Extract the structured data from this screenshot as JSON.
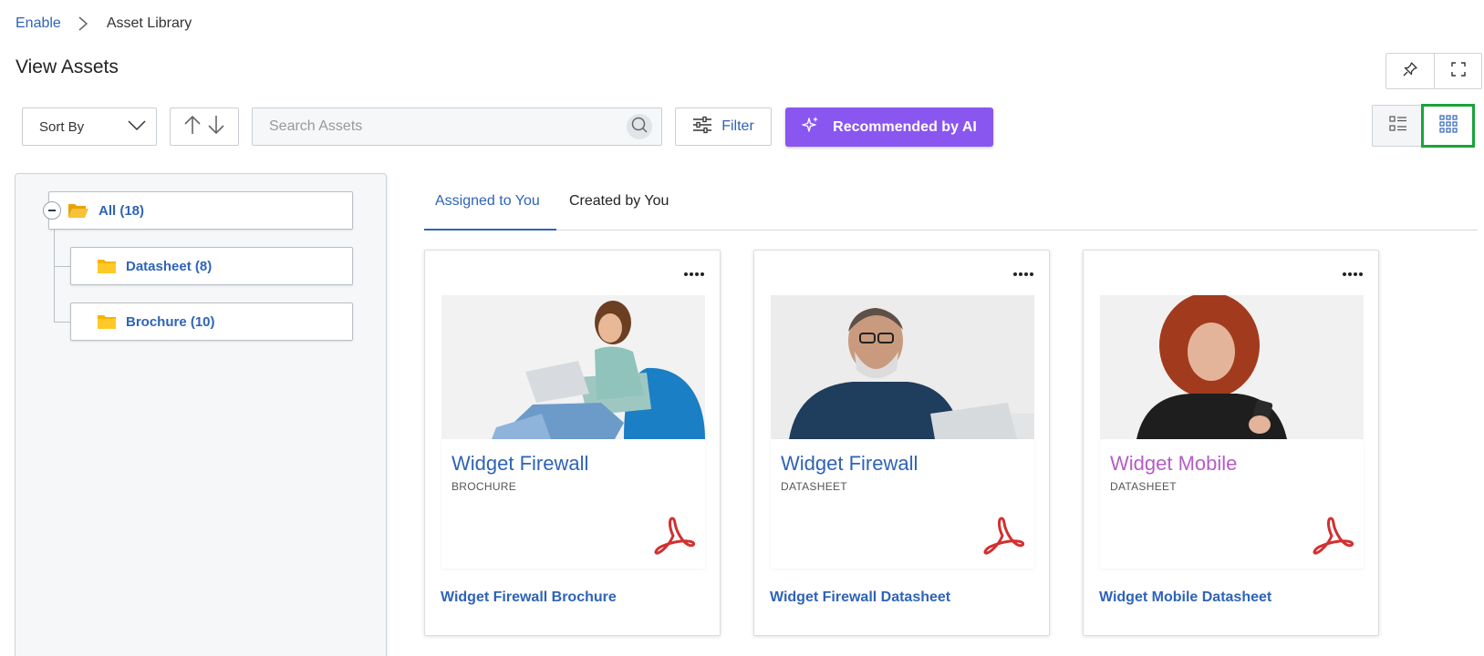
{
  "breadcrumb": {
    "root": "Enable",
    "current": "Asset Library"
  },
  "page": {
    "title": "View Assets"
  },
  "toolbar": {
    "sort_label": "Sort By",
    "search_placeholder": "Search Assets",
    "filter_label": "Filter",
    "ai_label": "Recommended by AI",
    "active_view": "grid"
  },
  "tree": {
    "root": {
      "label": "All (18)"
    },
    "children": [
      {
        "label": "Datasheet (8)"
      },
      {
        "label": "Brochure (10)"
      }
    ]
  },
  "tabs": [
    {
      "label": "Assigned to You",
      "active": true
    },
    {
      "label": "Created by You",
      "active": false
    }
  ],
  "cards": [
    {
      "title": "Widget Firewall",
      "type": "BROCHURE",
      "link": "Widget Firewall Brochure",
      "title_color": "#2f63b8"
    },
    {
      "title": "Widget Firewall",
      "type": "DATASHEET",
      "link": "Widget Firewall Datasheet",
      "title_color": "#2f63b8"
    },
    {
      "title": "Widget Mobile",
      "type": "DATASHEET",
      "link": "Widget Mobile Datasheet",
      "title_color": "#b55cc7"
    }
  ],
  "colors": {
    "accent": "#2f63b8",
    "ai_button": "#8a56f0",
    "highlight": "#1aa33a",
    "folder": "#f5b400",
    "pdf": "#d32f2f"
  }
}
